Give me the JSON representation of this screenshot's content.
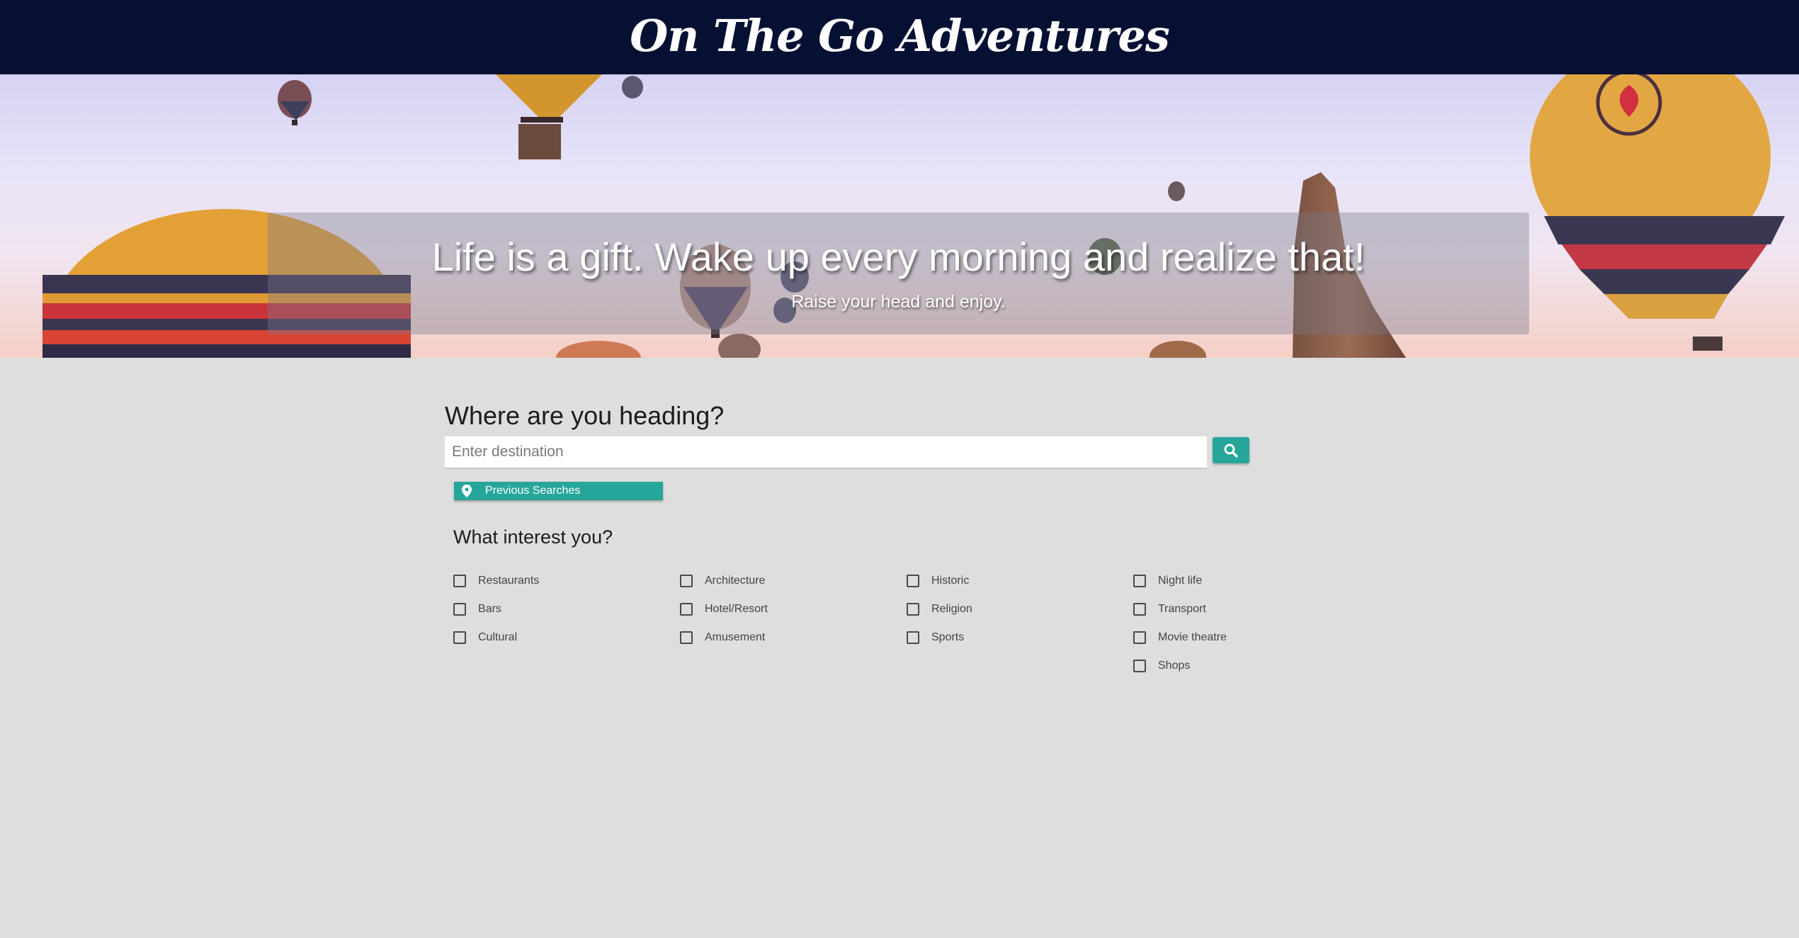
{
  "header": {
    "site_title": "On The Go Adventures"
  },
  "hero": {
    "quote": "Life is a gift. Wake up every morning and realize that!",
    "subtitle": "Raise your head and enjoy."
  },
  "search": {
    "heading": "Where are you heading?",
    "placeholder": "Enter destination",
    "value": "",
    "button_icon": "search-icon",
    "previous_searches_label": "Previous Searches",
    "previous_searches_icon": "location-pin-icon"
  },
  "interests": {
    "heading": "What interest you?",
    "columns": [
      [
        {
          "label": "Restaurants",
          "checked": false
        },
        {
          "label": "Bars",
          "checked": false
        },
        {
          "label": "Cultural",
          "checked": false
        }
      ],
      [
        {
          "label": "Architecture",
          "checked": false
        },
        {
          "label": "Hotel/Resort",
          "checked": false
        },
        {
          "label": "Amusement",
          "checked": false
        }
      ],
      [
        {
          "label": "Historic",
          "checked": false
        },
        {
          "label": "Religion",
          "checked": false
        },
        {
          "label": "Sports",
          "checked": false
        }
      ],
      [
        {
          "label": "Night life",
          "checked": false
        },
        {
          "label": "Transport",
          "checked": false
        },
        {
          "label": "Movie theatre",
          "checked": false
        },
        {
          "label": "Shops",
          "checked": false
        }
      ]
    ]
  },
  "colors": {
    "header_bg": "#061033",
    "accent": "#26a69a",
    "page_bg": "#dedede"
  }
}
